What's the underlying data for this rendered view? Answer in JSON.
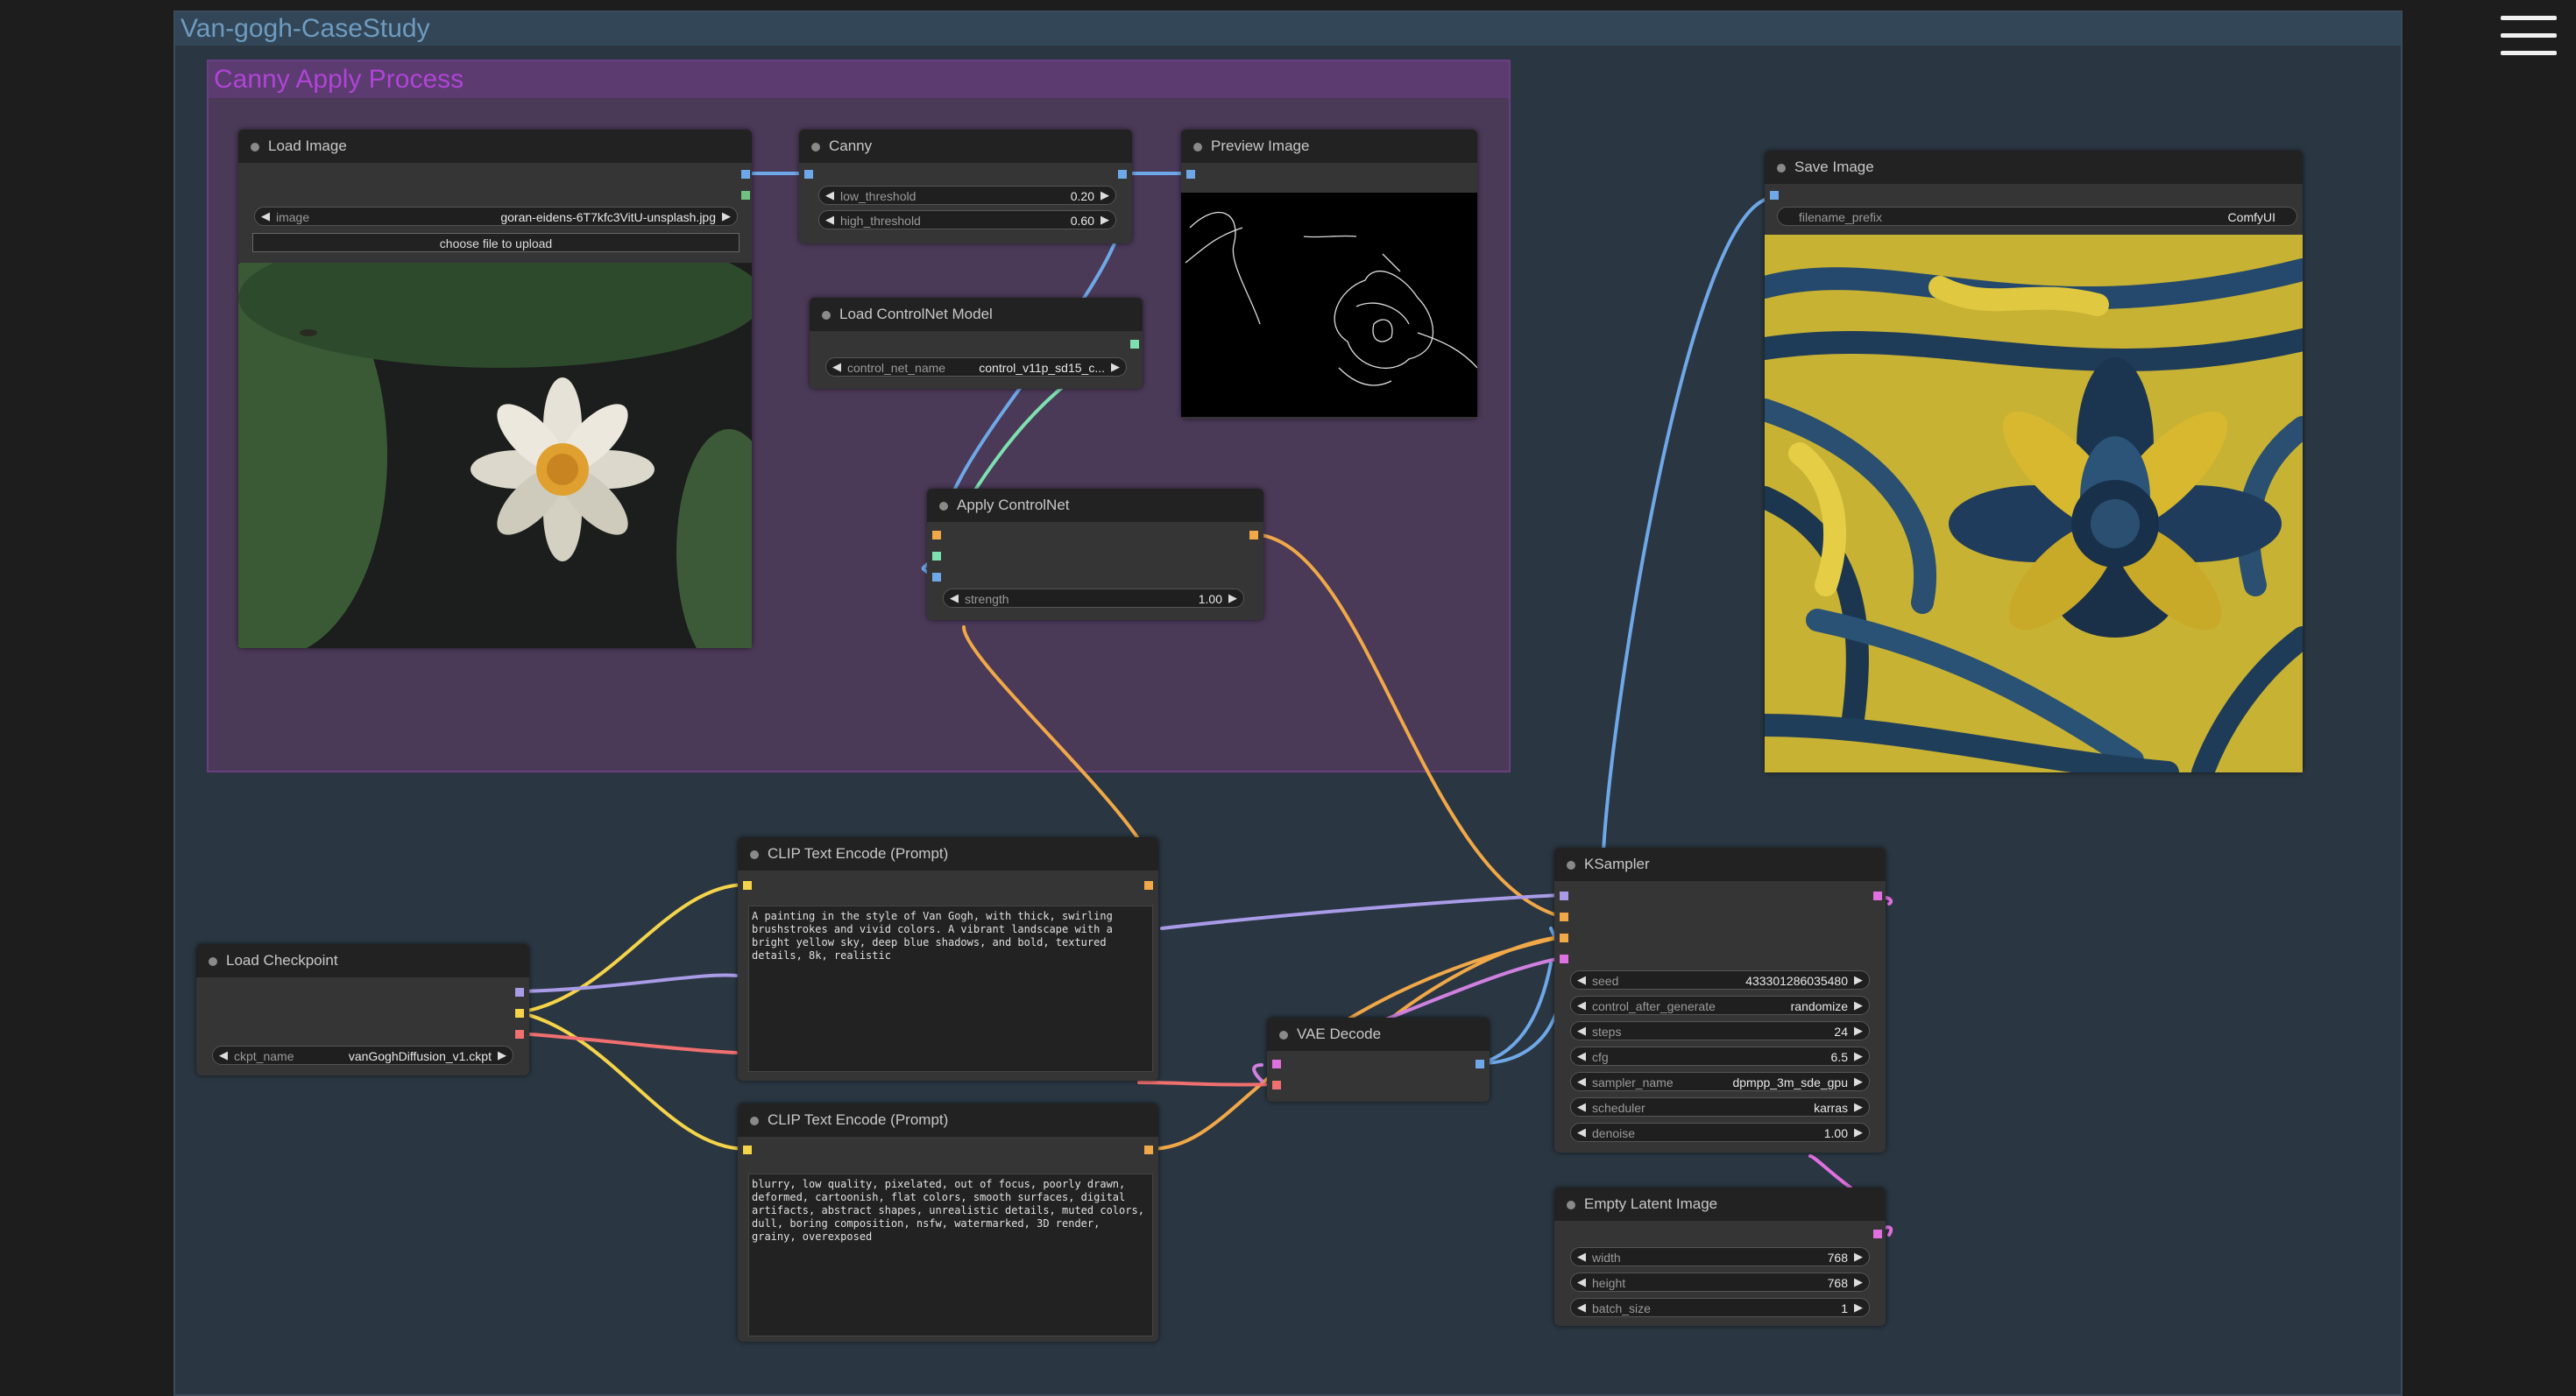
{
  "groups": {
    "main": "Van-gogh-CaseStudy",
    "canny": "Canny Apply Process"
  },
  "nodes": {
    "load_image": {
      "title": "Load Image",
      "image_label": "image",
      "image_value": "goran-eidens-6T7kfc3VitU-unsplash.jpg",
      "upload_button": "choose file to upload"
    },
    "canny": {
      "title": "Canny",
      "low_label": "low_threshold",
      "low_value": "0.20",
      "high_label": "high_threshold",
      "high_value": "0.60"
    },
    "preview_image": {
      "title": "Preview Image"
    },
    "load_controlnet": {
      "title": "Load ControlNet Model",
      "cn_label": "control_net_name",
      "cn_value": "control_v11p_sd15_c..."
    },
    "apply_controlnet": {
      "title": "Apply ControlNet",
      "strength_label": "strength",
      "strength_value": "1.00"
    },
    "save_image": {
      "title": "Save Image",
      "prefix_label": "filename_prefix",
      "prefix_value": "ComfyUI"
    },
    "clip_pos": {
      "title": "CLIP Text Encode (Prompt)",
      "text": "A painting in the style of Van Gogh, with thick, swirling\nbrushstrokes and vivid colors. A vibrant landscape with a\nbright yellow sky, deep blue shadows, and bold, textured\ndetails, 8k, realistic"
    },
    "clip_neg": {
      "title": "CLIP Text Encode (Prompt)",
      "text": "blurry, low quality, pixelated, out of focus, poorly drawn,\ndeformed, cartoonish, flat colors, smooth surfaces, digital\nartifacts, abstract shapes, unrealistic details, muted colors,\ndull, boring composition, nsfw, watermarked, 3D render,\ngrainy, overexposed"
    },
    "load_checkpoint": {
      "title": "Load Checkpoint",
      "ckpt_label": "ckpt_name",
      "ckpt_value": "vanGoghDiffusion_v1.ckpt"
    },
    "vae_decode": {
      "title": "VAE Decode"
    },
    "ksampler": {
      "title": "KSampler",
      "widgets": [
        {
          "label": "seed",
          "value": "433301286035480"
        },
        {
          "label": "control_after_generate",
          "value": "randomize"
        },
        {
          "label": "steps",
          "value": "24"
        },
        {
          "label": "cfg",
          "value": "6.5"
        },
        {
          "label": "sampler_name",
          "value": "dpmpp_3m_sde_gpu"
        },
        {
          "label": "scheduler",
          "value": "karras"
        },
        {
          "label": "denoise",
          "value": "1.00"
        }
      ]
    },
    "empty_latent": {
      "title": "Empty Latent Image",
      "widgets": [
        {
          "label": "width",
          "value": "768"
        },
        {
          "label": "height",
          "value": "768"
        },
        {
          "label": "batch_size",
          "value": "1"
        }
      ]
    }
  },
  "colors": {
    "image_link": "#6fa8e8",
    "controlnet_link": "#7ee0b0",
    "conditioning_link": "#f0a848",
    "clip_link": "#f5d44a",
    "model_link": "#a99be8",
    "vae_link": "#f07070",
    "latent_link": "#e070e0"
  },
  "icons": {
    "menu": "hamburger-menu-icon",
    "arrow_left": "◀",
    "arrow_right": "▶"
  }
}
